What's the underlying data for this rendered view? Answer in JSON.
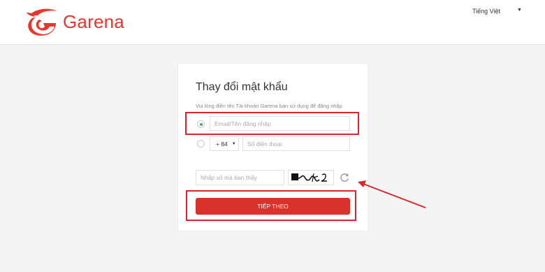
{
  "header": {
    "brand": "Garena",
    "language": "Tiếng Việt"
  },
  "form": {
    "title": "Thay đổi mật khẩu",
    "instruction": "Vui lòng điền tên Tài khoản Garena bạn sử dụng để đăng nhập",
    "email_option": {
      "placeholder": "Email/Tên đăng nhập",
      "selected": true
    },
    "phone_option": {
      "country_code": "+ 84",
      "placeholder": "Số điện thoại",
      "selected": false
    },
    "captcha": {
      "placeholder": "Nhập số mà bạn thấy",
      "image_text": "ngu̇2"
    },
    "submit_label": "TIẾP THEO"
  },
  "colors": {
    "brand_red": "#e8362d",
    "button_red": "#d9322b",
    "highlight_red": "#d9252b",
    "radio_green": "#4caf50"
  },
  "icons": [
    "garena-logo-icon",
    "caret-down-icon",
    "refresh-icon",
    "arrow-annotation-icon"
  ]
}
